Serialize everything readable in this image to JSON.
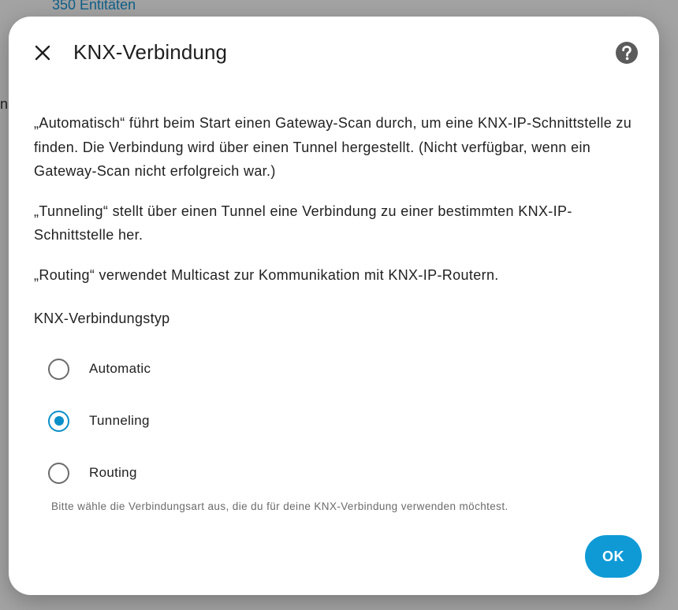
{
  "background": {
    "entities_text": "350 Entitäten",
    "fragment_text": "n"
  },
  "dialog": {
    "title": "KNX-Verbindung",
    "close_icon": "close-icon",
    "help_icon": "help-circle-icon",
    "description": [
      "„Automatisch“ führt beim Start einen Gateway-Scan durch, um eine KNX-IP-Schnittstelle zu finden. Die Verbindung wird über einen Tunnel hergestellt. (Nicht verfügbar, wenn ein Gateway-Scan nicht erfolgreich war.)",
      "„Tunneling“ stellt über einen Tunnel eine Verbindung zu einer bestimmten KNX-IP-Schnittstelle her.",
      "„Routing“ verwendet Multicast zur Kommunikation mit KNX-IP-Routern."
    ],
    "field_label": "KNX-Verbindungstyp",
    "options": [
      {
        "label": "Automatic",
        "checked": false
      },
      {
        "label": "Tunneling",
        "checked": true
      },
      {
        "label": "Routing",
        "checked": false
      }
    ],
    "helper_text": "Bitte wähle die Verbindungsart aus, die du für deine KNX-Verbindung verwenden möchtest.",
    "ok_label": "OK"
  },
  "colors": {
    "accent": "#0f9ad6",
    "radio_checked": "#0b8fc8",
    "scrim": "#a3a3a3"
  }
}
